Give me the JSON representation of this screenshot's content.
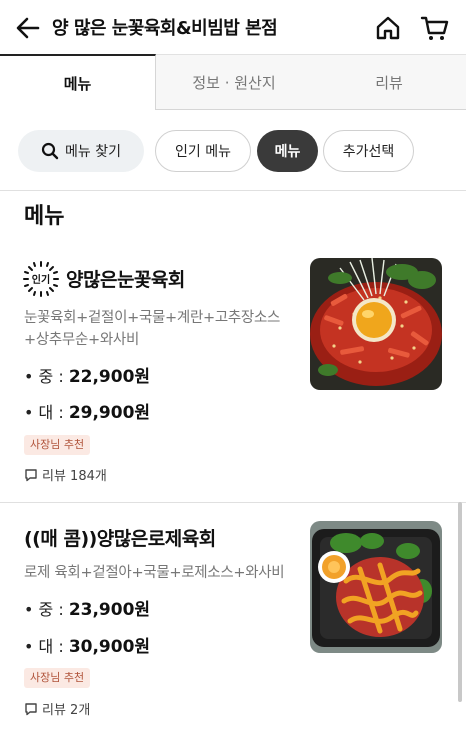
{
  "header": {
    "title": "양 많은 눈꽃육회&비빔밥 본점"
  },
  "tabs": [
    {
      "label": "메뉴",
      "active": true
    },
    {
      "label": "정보 · 원산지",
      "active": false
    },
    {
      "label": "리뷰",
      "active": false
    }
  ],
  "chips": {
    "search": "메뉴 찾기",
    "popular": "인기 메뉴",
    "menu": "메뉴",
    "extra": "추가선택"
  },
  "section_title": "메뉴",
  "items": [
    {
      "popular_badge": "인기",
      "name": "양많은눈꽃육회",
      "description": "눈꽃육회+겉절이+국물+계란+고추장소스+상추무순+와사비",
      "prices": [
        {
          "label": "• 중 : ",
          "value": "22,900원"
        },
        {
          "label": "• 대 : ",
          "value": "29,900원"
        }
      ],
      "owner_badge": "사장님 추천",
      "review": "리뷰 184개"
    },
    {
      "name": "((매 콤))양많은로제육회",
      "description": "로제 육회+겉절아+국물+로제소스+와사비",
      "prices": [
        {
          "label": "• 중 : ",
          "value": "23,900원"
        },
        {
          "label": "• 대 : ",
          "value": "30,900원"
        }
      ],
      "owner_badge": "사장님 추천",
      "review": "리뷰 2개"
    }
  ],
  "colors": {
    "selected_chip": "#3a3a3a",
    "badge_bg": "#fbe9e3",
    "badge_text": "#b0533a"
  }
}
